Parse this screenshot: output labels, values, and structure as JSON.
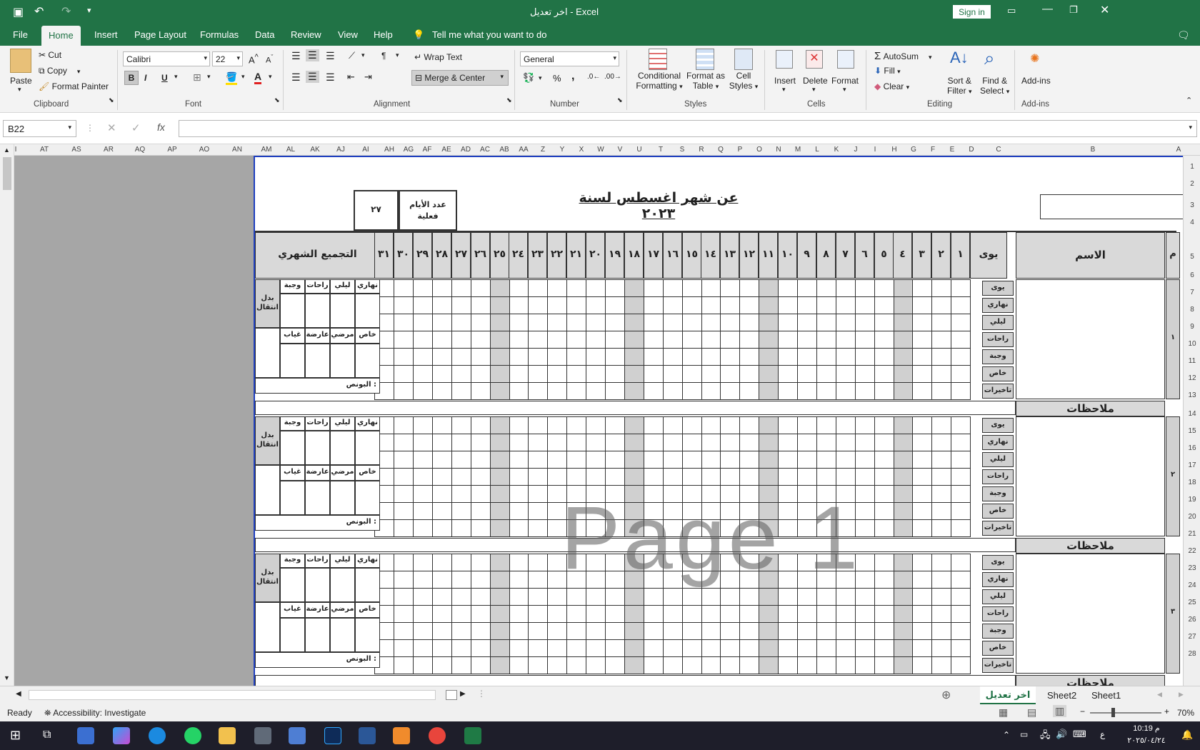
{
  "window": {
    "title": "اخر تعديل  -  Excel",
    "signin": "Sign in"
  },
  "ribbon_tabs": [
    "File",
    "Home",
    "Insert",
    "Page Layout",
    "Formulas",
    "Data",
    "Review",
    "View",
    "Help"
  ],
  "tell_me": "Tell me what you want to do",
  "clipboard": {
    "paste": "Paste",
    "cut": "Cut",
    "copy": "Copy",
    "format_painter": "Format Painter",
    "group": "Clipboard"
  },
  "font": {
    "name": "Calibri",
    "size": "22",
    "group": "Font",
    "bold": "B",
    "italic": "I",
    "underline": "U"
  },
  "alignment": {
    "wrap": "Wrap Text",
    "merge": "Merge & Center",
    "group": "Alignment"
  },
  "number": {
    "format": "General",
    "group": "Number",
    "percent": "%",
    "comma": ","
  },
  "styles": {
    "cond1": "Conditional",
    "cond2": "Formatting",
    "fmt1": "Format as",
    "fmt2": "Table",
    "cell1": "Cell",
    "cell2": "Styles",
    "group": "Styles"
  },
  "cells": {
    "insert": "Insert",
    "delete": "Delete",
    "format": "Format",
    "group": "Cells"
  },
  "editing": {
    "autosum": "AutoSum",
    "fill": "Fill",
    "clear": "Clear",
    "sort1": "Sort &",
    "sort2": "Filter",
    "find1": "Find &",
    "find2": "Select",
    "group": "Editing"
  },
  "addins": {
    "label": "Add-ins",
    "group": "Add-ins"
  },
  "namebox": "B22",
  "fx": "fx",
  "col_headers": [
    "I",
    "AT",
    "AS",
    "AR",
    "AQ",
    "AP",
    "AO",
    "AN",
    "AM",
    "AL",
    "AK",
    "AJ",
    "AI",
    "AH",
    "AG",
    "AF",
    "AE",
    "AD",
    "AC",
    "AB",
    "AA",
    "Z",
    "Y",
    "X",
    "W",
    "V",
    "U",
    "T",
    "S",
    "R",
    "Q",
    "P",
    "O",
    "N",
    "M",
    "L",
    "K",
    "J",
    "I",
    "H",
    "G",
    "F",
    "E",
    "D",
    "C",
    "B",
    "A"
  ],
  "row_numbers": [
    "1",
    "2",
    "3",
    "4",
    "5",
    "6",
    "7",
    "8",
    "9",
    "10",
    "11",
    "12",
    "13",
    "14",
    "15",
    "16",
    "17",
    "18",
    "19",
    "20",
    "21",
    "22",
    "23",
    "24",
    "25",
    "26",
    "27",
    "28"
  ],
  "sheet": {
    "title": "عن شهر اغسطس لسنة ٢٠٢٣",
    "days_label_1": "عدد الأيام",
    "days_label_2": "فعلية",
    "days_value": "٢٧",
    "monthly_total": "التجميع الشهري",
    "day_header": "يوى",
    "name_header": "الاسم",
    "m_header": "م",
    "days": [
      "١",
      "٢",
      "٣",
      "٤",
      "٥",
      "٦",
      "٧",
      "٨",
      "٩",
      "١٠",
      "١١",
      "١٢",
      "١٣",
      "١٤",
      "١٥",
      "١٦",
      "١٧",
      "١٨",
      "١٩",
      "٢٠",
      "٢١",
      "٢٢",
      "٢٣",
      "٢٤",
      "٢٥",
      "٢٦",
      "٢٧",
      "٢٨",
      "٢٩",
      "٣٠",
      "٣١"
    ],
    "row_labels": [
      "يوى",
      "نهاري",
      "ليلي",
      "راحات",
      "وجبة",
      "خاص",
      "تاخيرات"
    ],
    "summary_top": [
      "نهاري",
      "ليلي",
      "راحات",
      "وجبة"
    ],
    "summary_bottom": [
      "خاص",
      "مرضي",
      "عارضة",
      "غياب"
    ],
    "transfer": "بدل انتقال",
    "bonus": "البونص :",
    "notes": "ملاحظات",
    "employees": [
      "١",
      "٢",
      "٣"
    ]
  },
  "watermark": "Page 1",
  "sheet_tabs": [
    "اخر تعديل",
    "Sheet2",
    "Sheet1"
  ],
  "status": {
    "ready": "Ready",
    "accessibility": "Accessibility: Investigate",
    "zoom": "70%"
  },
  "clock": {
    "time": "10:19 م",
    "date": "٢٠٢٥/٠٤/٢٤",
    "lang": "ع"
  }
}
